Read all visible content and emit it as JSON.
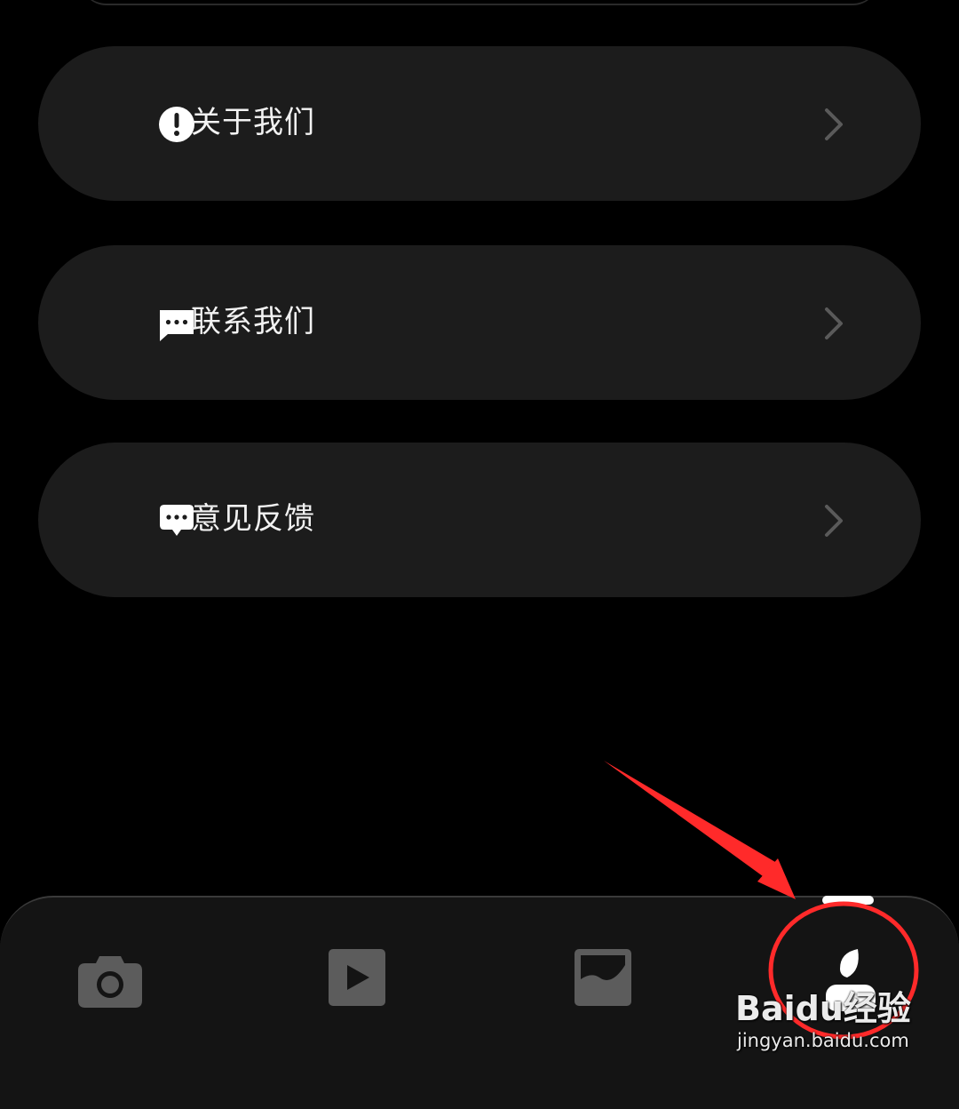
{
  "menu": {
    "items": [
      {
        "label": "关于我们",
        "icon": "exclamation-circle-icon"
      },
      {
        "label": "联系我们",
        "icon": "message-dots-icon"
      },
      {
        "label": "意见反馈",
        "icon": "feedback-bubble-icon"
      }
    ]
  },
  "bottom_nav": {
    "items": [
      {
        "icon": "camera-icon",
        "active": false
      },
      {
        "icon": "play-icon",
        "active": false
      },
      {
        "icon": "gallery-icon",
        "active": false
      },
      {
        "icon": "profile-icon",
        "active": true
      }
    ]
  },
  "watermark": {
    "brand": "Baidu经验",
    "url": "jingyan.baidu.com"
  },
  "colors": {
    "background": "#000000",
    "card": "#1c1c1c",
    "text": "#f2f2f2",
    "chevron": "#5a5a5a",
    "nav_inactive": "#5c5c5c",
    "nav_active": "#ffffff",
    "annotation": "#ff2a2a"
  }
}
